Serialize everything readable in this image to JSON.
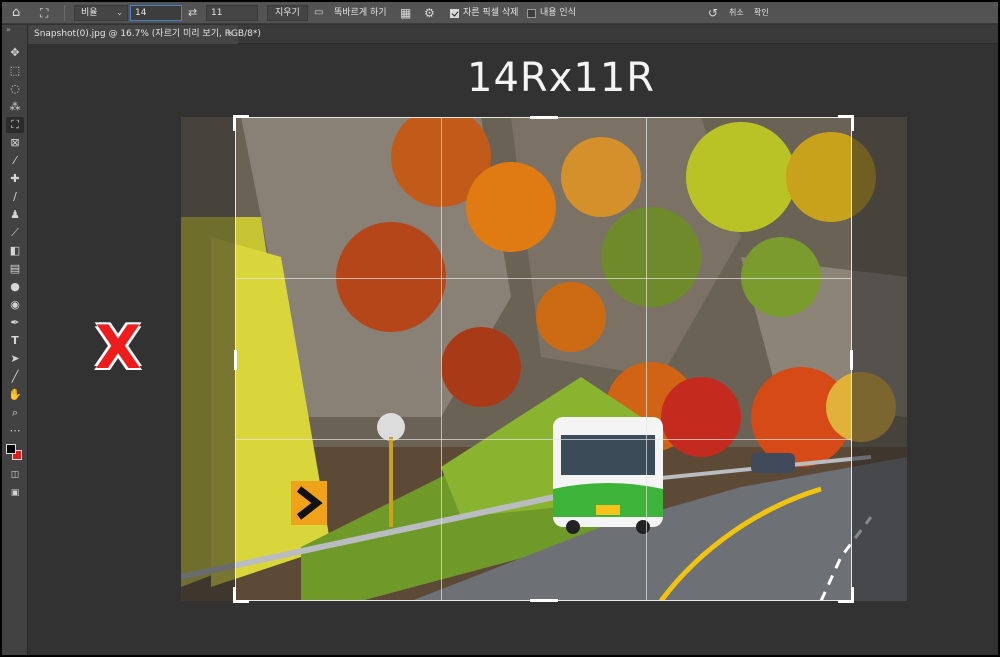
{
  "options_bar": {
    "ratio_select": "비율",
    "width_value": "14",
    "height_value": "11",
    "clear_label": "지우기",
    "straighten_label": "똑바르게 하기",
    "delete_pixels_label": "자른 픽셀 삭제",
    "delete_pixels_checked": true,
    "content_aware_label": "내용 인식",
    "content_aware_checked": false,
    "cancel_label": "취소",
    "commit_label": "확인"
  },
  "document_tab": {
    "title": "Snapshot(0).jpg @ 16.7% (자르기 미리 보기, RGB/8*)",
    "close": "×"
  },
  "canvas": {
    "overlay_label": "14Rx11R",
    "mark": "X"
  },
  "tools": [
    "move-tool",
    "marquee-tool",
    "lasso-tool",
    "magic-wand-tool",
    "crop-tool",
    "frame-tool",
    "eyedropper-tool",
    "healing-brush-tool",
    "brush-tool",
    "clone-stamp-tool",
    "history-brush-tool",
    "eraser-tool",
    "gradient-tool",
    "blur-tool",
    "dodge-tool",
    "pen-tool",
    "type-tool",
    "path-selection-tool",
    "line-tool",
    "hand-tool",
    "zoom-tool",
    "more-tools"
  ],
  "colors": {
    "foreground": "#000000",
    "background": "#e01b1b",
    "accent_x": "#ee1c1c"
  }
}
